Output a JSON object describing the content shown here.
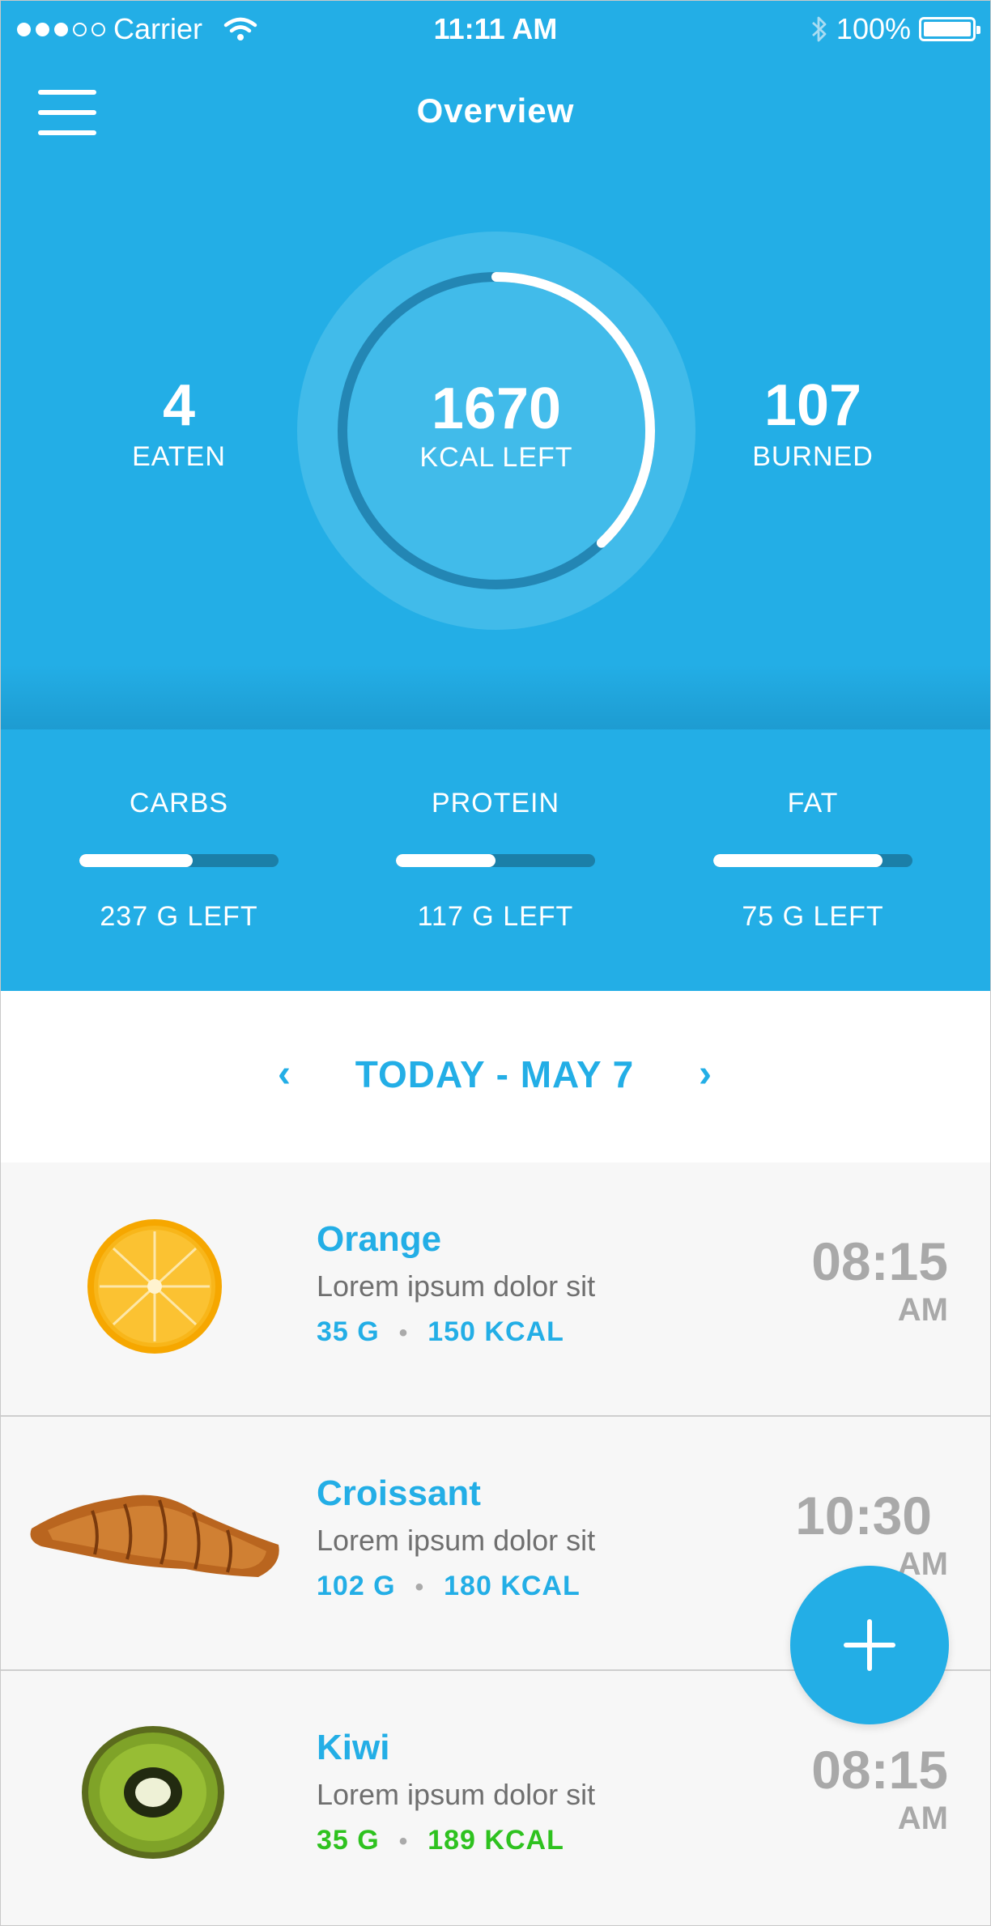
{
  "status_bar": {
    "carrier": "Carrier",
    "time": "11:11 AM",
    "battery": "100%",
    "signal_dots_filled": 3,
    "signal_dots_total": 5
  },
  "header": {
    "title": "Overview",
    "menu_icon": "hamburger-icon"
  },
  "summary": {
    "eaten_value": "4",
    "eaten_label": "EATEN",
    "kcal_value": "1670",
    "kcal_label": "KCAL LEFT",
    "burned_value": "107",
    "burned_label": "BURNED",
    "ring_progress": 0.38
  },
  "macros": [
    {
      "name": "CARBS",
      "left": "237 G LEFT",
      "progress": 0.57
    },
    {
      "name": "PROTEIN",
      "left": "117 G LEFT",
      "progress": 0.5
    },
    {
      "name": "FAT",
      "left": "75 G LEFT",
      "progress": 0.85
    }
  ],
  "date_nav": {
    "label": "TODAY - MAY 7",
    "prev_icon": "chevron-left-icon",
    "next_icon": "chevron-right-icon"
  },
  "meals": [
    {
      "name": "Orange",
      "description": "Lorem ipsum dolor sit",
      "grams": "35 G",
      "kcal": "150 KCAL",
      "time": "08:15",
      "ampm": "AM",
      "separator": "•"
    },
    {
      "name": "Croissant",
      "description": "Lorem ipsum dolor sit",
      "grams": "102 G",
      "kcal": "180 KCAL",
      "time": "10:30",
      "ampm": "AM",
      "separator": "•"
    },
    {
      "name": "Kiwi",
      "description": "Lorem ipsum dolor sit",
      "grams": "35 G",
      "kcal": "189 KCAL",
      "time": "08:15",
      "ampm": "AM",
      "separator": "•"
    }
  ],
  "fab": {
    "icon": "plus-icon"
  },
  "colors": {
    "primary": "#23aee6",
    "track": "#1b7fa8",
    "green": "#2ec21f",
    "muted": "#a9a9a9"
  }
}
